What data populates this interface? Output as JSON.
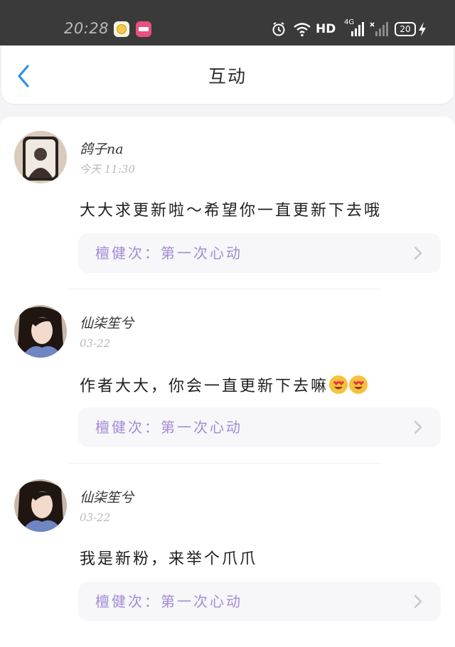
{
  "status_bar": {
    "time": "20:28",
    "network_label": "HD",
    "network_sub": "4G",
    "battery": "20",
    "icons": [
      "cat-app-icon",
      "bilibili-app-icon",
      "alarm-icon",
      "wifi-icon",
      "signal-icon",
      "signal-icon",
      "battery-icon",
      "charging-icon"
    ]
  },
  "header": {
    "title": "互动",
    "back_icon": "chevron-left-icon",
    "accent_color": "#2f8fe8"
  },
  "comments": [
    {
      "username": "鸽子na",
      "time": "今天 11:30",
      "text": "大大求更新啦～希望你一直更新下去哦",
      "emojis": 0,
      "work_label": "檀健次：第一次心动"
    },
    {
      "username": "仙柒笙兮",
      "time": "03-22",
      "text": "作者大大，你会一直更新下去嘛",
      "emojis": 2,
      "work_label": "檀健次：第一次心动"
    },
    {
      "username": "仙柒笙兮",
      "time": "03-22",
      "text": "我是新粉，来举个爪爪",
      "emojis": 0,
      "work_label": "檀健次：第一次心动"
    }
  ],
  "colors": {
    "status_bar_bg": "#3a3a3a",
    "work_label": "#a38ad6",
    "time_text": "#b9b9b9",
    "page_bg": "#f4f4f6"
  }
}
